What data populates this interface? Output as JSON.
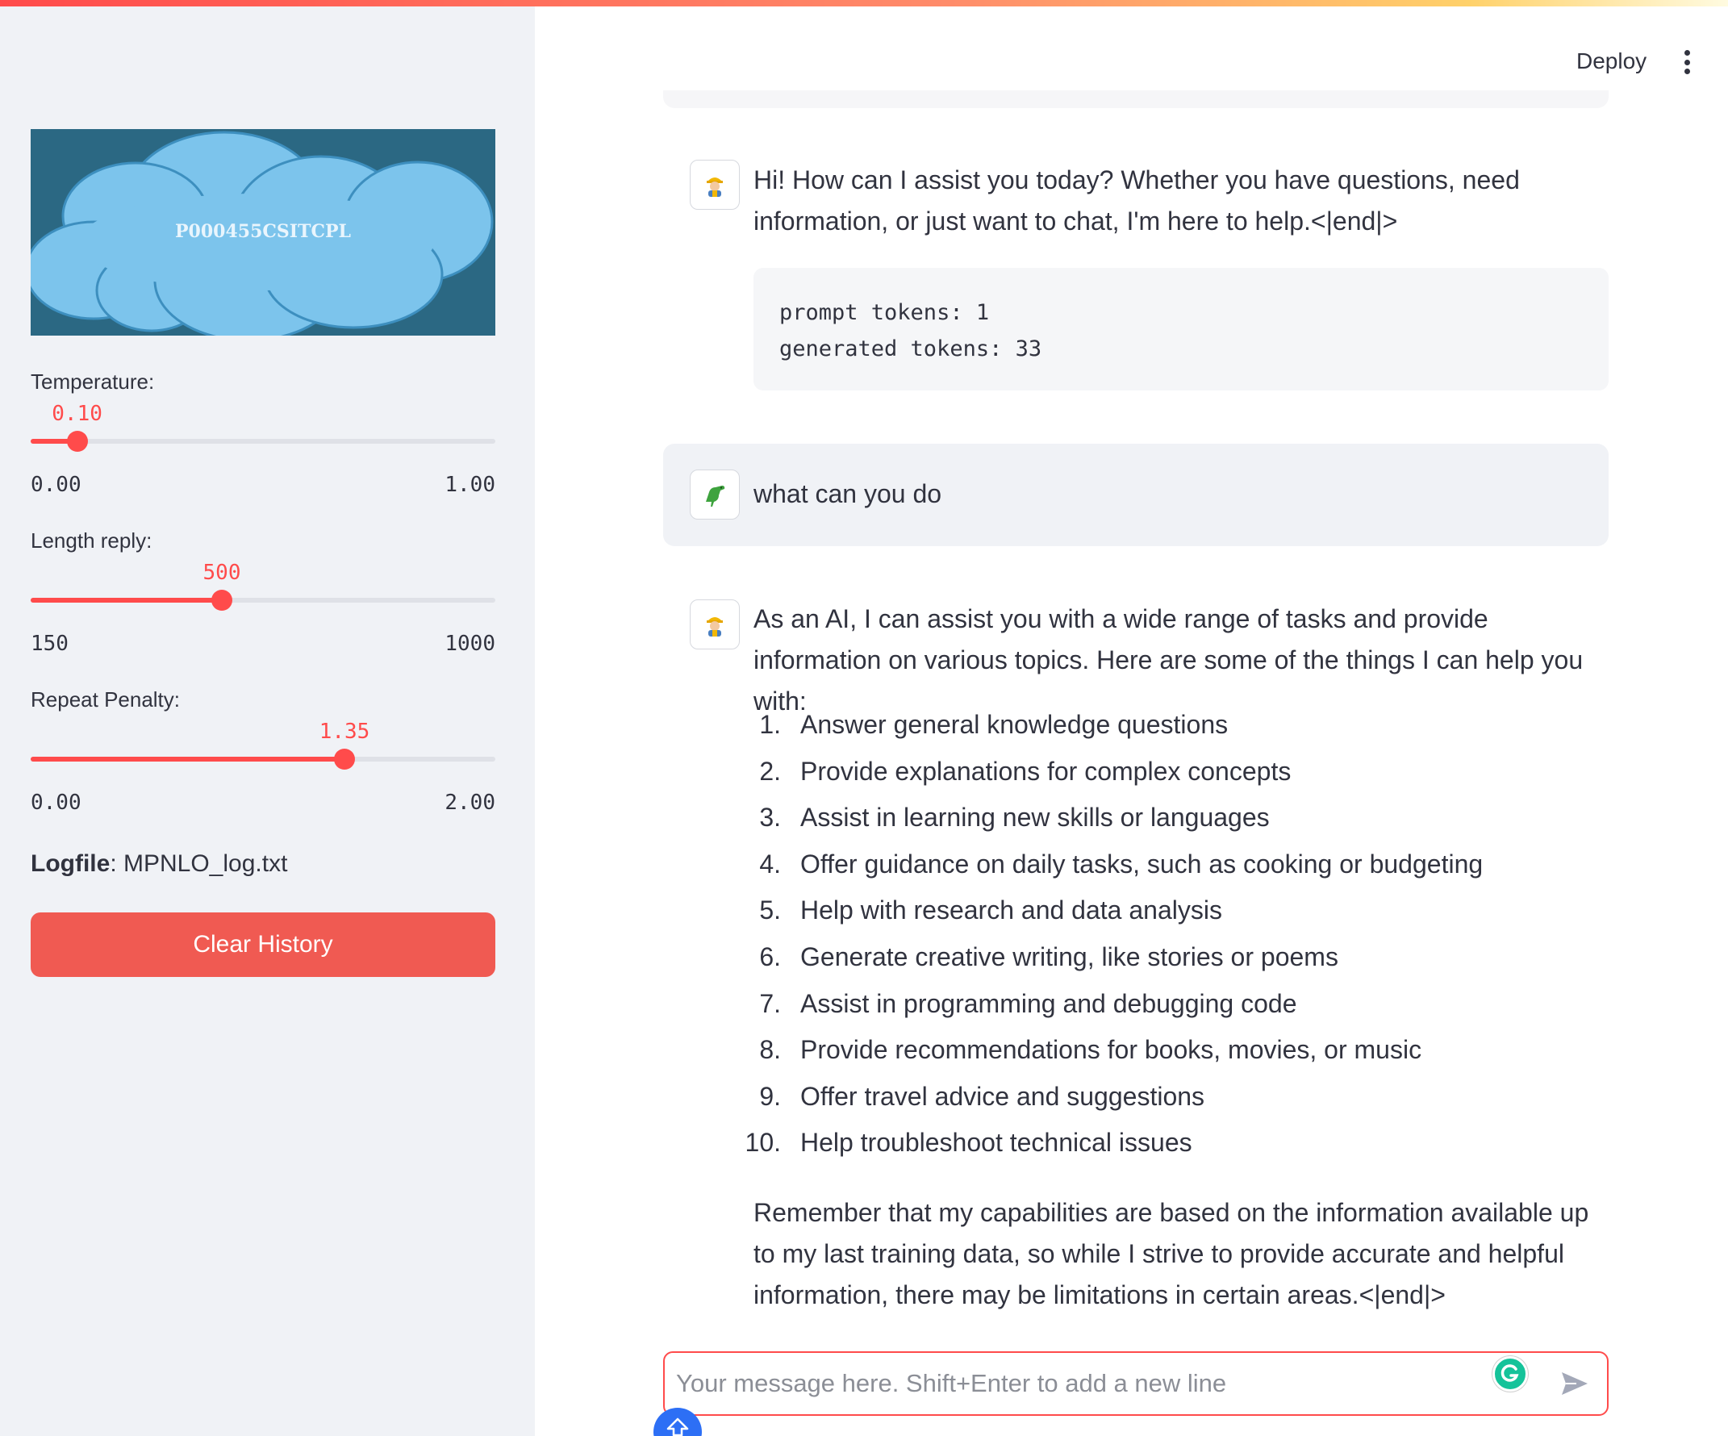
{
  "sidebar": {
    "logo_text": "P000455CSITCPL",
    "sliders": [
      {
        "label": "Temperature:",
        "value": "0.10",
        "min": "0.00",
        "max": "1.00",
        "fraction": 0.1
      },
      {
        "label": "Length reply:",
        "value": "500",
        "min": "150",
        "max": "1000",
        "fraction": 0.4118
      },
      {
        "label": "Repeat Penalty:",
        "value": "1.35",
        "min": "0.00",
        "max": "2.00",
        "fraction": 0.675
      }
    ],
    "logfile_label": "Logfile",
    "logfile_name": ": MPNLO_log.txt",
    "clear_button": "Clear History"
  },
  "header": {
    "deploy": "Deploy"
  },
  "chat": {
    "messages": [
      {
        "role": "assistant",
        "avatar_icon": "robot-worker-icon",
        "text": "Hi! How can I assist you today? Whether you have questions, need information, or just want to chat, I'm here to help.<|end|>",
        "stats": "prompt tokens: 1\ngenerated tokens: 33"
      },
      {
        "role": "user",
        "avatar_icon": "dinosaur-icon",
        "text": "what can you do"
      },
      {
        "role": "assistant",
        "avatar_icon": "robot-worker-icon",
        "intro": "As an AI, I can assist you with a wide range of tasks and provide information on various topics. Here are some of the things I can help you with:",
        "list": [
          "Answer general knowledge questions",
          "Provide explanations for complex concepts",
          "Assist in learning new skills or languages",
          "Offer guidance on daily tasks, such as cooking or budgeting",
          "Help with research and data analysis",
          "Generate creative writing, like stories or poems",
          "Assist in programming and debugging code",
          "Provide recommendations for books, movies, or music",
          "Offer travel advice and suggestions",
          "Help troubleshoot technical issues"
        ],
        "outro": "Remember that my capabilities are based on the information available up to my last training data, so while I strive to provide accurate and helpful information, there may be limitations in certain areas.<|end|>"
      }
    ],
    "input_placeholder": "Your message here. Shift+Enter to add a new line"
  },
  "colors": {
    "accent": "#ff4b4b",
    "sidebar_bg": "#f0f2f6",
    "logo_bg": "#2b6883",
    "cloud": "#7cc4ec",
    "clear_button": "#f05a52",
    "text": "#31333f"
  }
}
